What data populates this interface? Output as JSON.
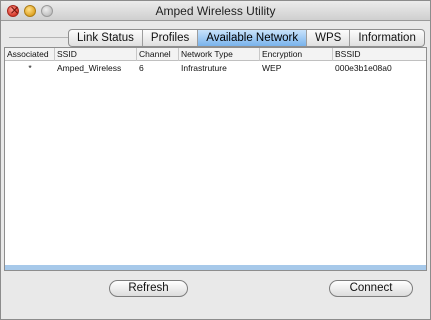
{
  "window": {
    "title": "Amped Wireless Utility"
  },
  "tabs": [
    {
      "label": "Link Status"
    },
    {
      "label": "Profiles"
    },
    {
      "label": "Available Network"
    },
    {
      "label": "WPS"
    },
    {
      "label": "Information"
    }
  ],
  "active_tab": "Available Network",
  "columns": [
    "Associated",
    "SSID",
    "Channel",
    "Network Type",
    "Encryption",
    "BSSID"
  ],
  "rows": [
    [
      "*",
      "Amped_Wireless",
      "6",
      "Infrastruture",
      "WEP",
      "000e3b1e08a0"
    ]
  ],
  "buttons": {
    "refresh_label": "Refresh",
    "connect_label": "Connect"
  },
  "colors": {
    "active_tab": "#79b2ec",
    "selection_strip": "#a7c9ea"
  }
}
